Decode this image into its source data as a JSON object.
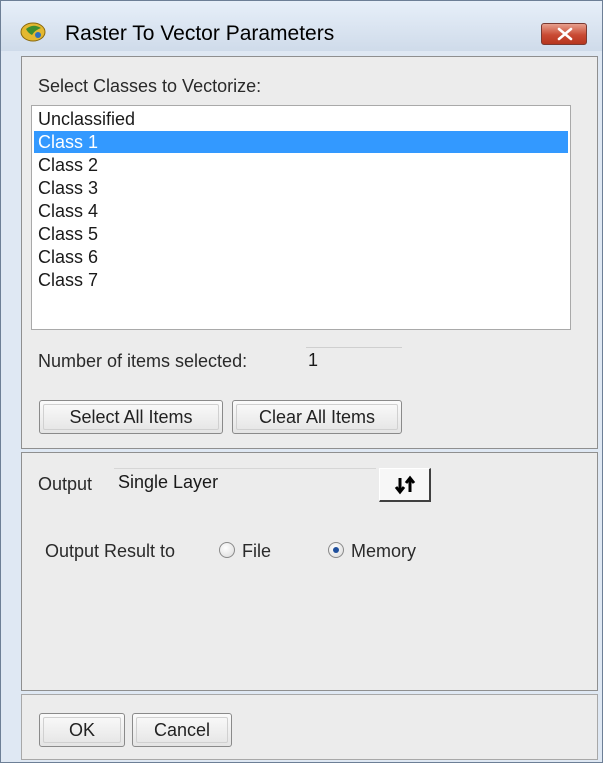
{
  "window": {
    "title": "Raster To Vector Parameters",
    "icon": "app-globe-icon",
    "close_icon": "close-x-icon",
    "close_color": "#c94a33"
  },
  "classes_section": {
    "label": "Select Classes to Vectorize:",
    "items": [
      {
        "label": "Unclassified",
        "selected": false
      },
      {
        "label": "Class 1",
        "selected": true
      },
      {
        "label": "Class 2",
        "selected": false
      },
      {
        "label": "Class 3",
        "selected": false
      },
      {
        "label": "Class 4",
        "selected": false
      },
      {
        "label": "Class 5",
        "selected": false
      },
      {
        "label": "Class 6",
        "selected": false
      },
      {
        "label": "Class 7",
        "selected": false
      }
    ],
    "selection_color": "#3399ff",
    "count_label": "Number of items selected:",
    "count_value": "1",
    "select_all_label": "Select All Items",
    "clear_all_label": "Clear All Items"
  },
  "output_section": {
    "output_label": "Output",
    "output_value": "Single Layer",
    "swap_icon": "swap-arrows-icon",
    "result_to_label": "Output Result to",
    "options": [
      {
        "label": "File",
        "checked": false
      },
      {
        "label": "Memory",
        "checked": true
      }
    ]
  },
  "footer": {
    "ok_label": "OK",
    "cancel_label": "Cancel"
  }
}
